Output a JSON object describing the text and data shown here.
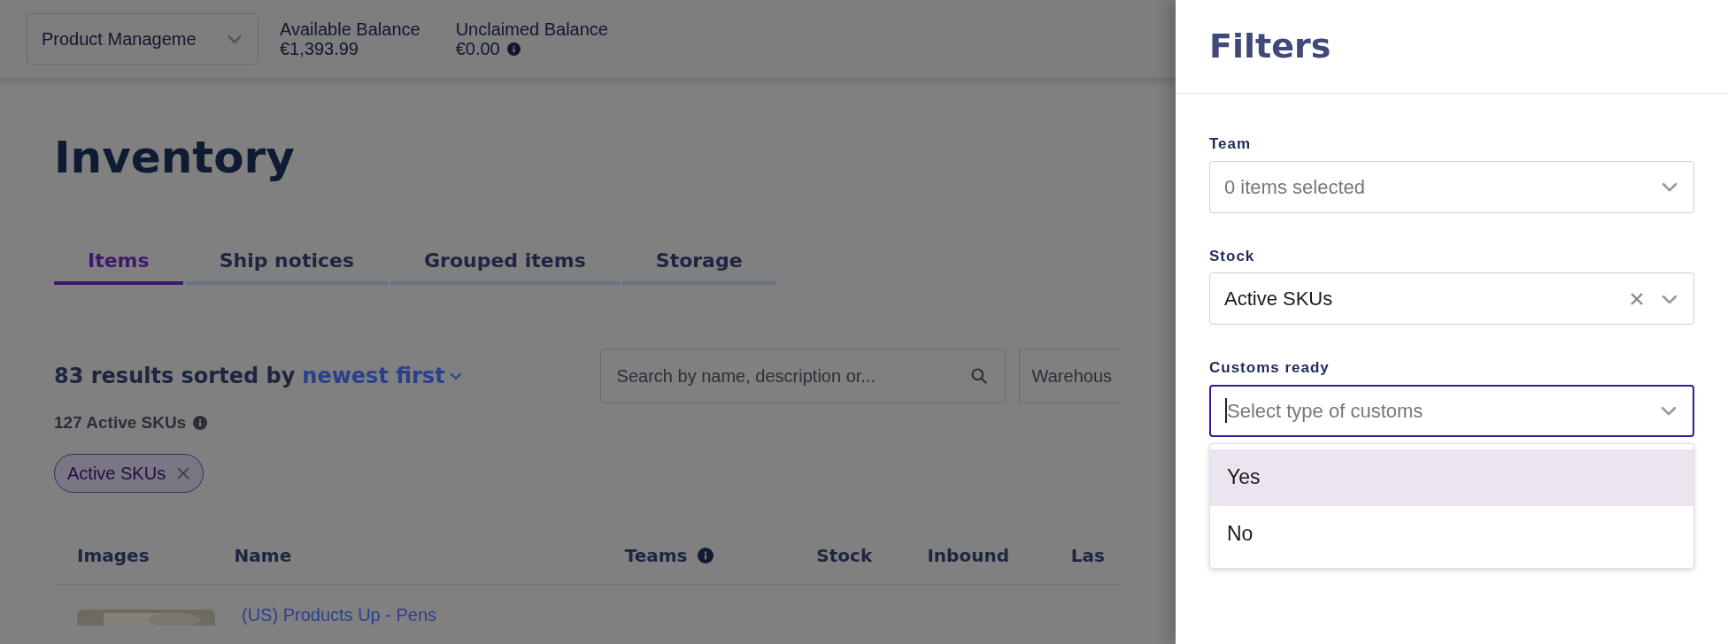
{
  "header": {
    "account_select": {
      "value": "Product Manageme"
    },
    "balances": [
      {
        "label": "Available Balance",
        "value": "€1,393.99",
        "info": false
      },
      {
        "label": "Unclaimed Balance",
        "value": "€0.00",
        "info": true
      }
    ]
  },
  "page": {
    "title": "Inventory",
    "tabs": [
      {
        "label": "Items",
        "selected": true
      },
      {
        "label": "Ship notices",
        "selected": false
      },
      {
        "label": "Grouped items",
        "selected": false
      },
      {
        "label": "Storage",
        "selected": false
      }
    ],
    "results": {
      "summary": "83 results sorted by",
      "sort": "newest first"
    },
    "active_skus": {
      "label": "127 Active SKUs",
      "info": true
    },
    "search": {
      "placeholder": "Search by name, description or..."
    },
    "warehouse": {
      "placeholder": "Warehous"
    },
    "chips": [
      {
        "label": "Active SKUs"
      }
    ],
    "table": {
      "columns": [
        {
          "label": "Images",
          "info": false
        },
        {
          "label": "Name",
          "info": false
        },
        {
          "label": "Teams",
          "info": true
        },
        {
          "label": "Stock",
          "info": false
        },
        {
          "label": "Inbound",
          "info": false
        },
        {
          "label": "Las",
          "info": false
        }
      ],
      "rows": [
        {
          "name": "(US) Products Up - Pens"
        }
      ]
    }
  },
  "filters": {
    "title": "Filters",
    "fields": [
      {
        "label": "Team",
        "placeholder": "0 items selected",
        "clearable": false,
        "focused": false
      },
      {
        "label": "Stock",
        "value": "Active SKUs",
        "clearable": true,
        "focused": false
      },
      {
        "label": "Customs ready",
        "placeholder": "Select type of customs",
        "clearable": false,
        "focused": true
      }
    ],
    "dropdown": {
      "options": [
        {
          "label": "Yes",
          "selected": true
        },
        {
          "label": "No",
          "selected": false
        }
      ]
    }
  }
}
